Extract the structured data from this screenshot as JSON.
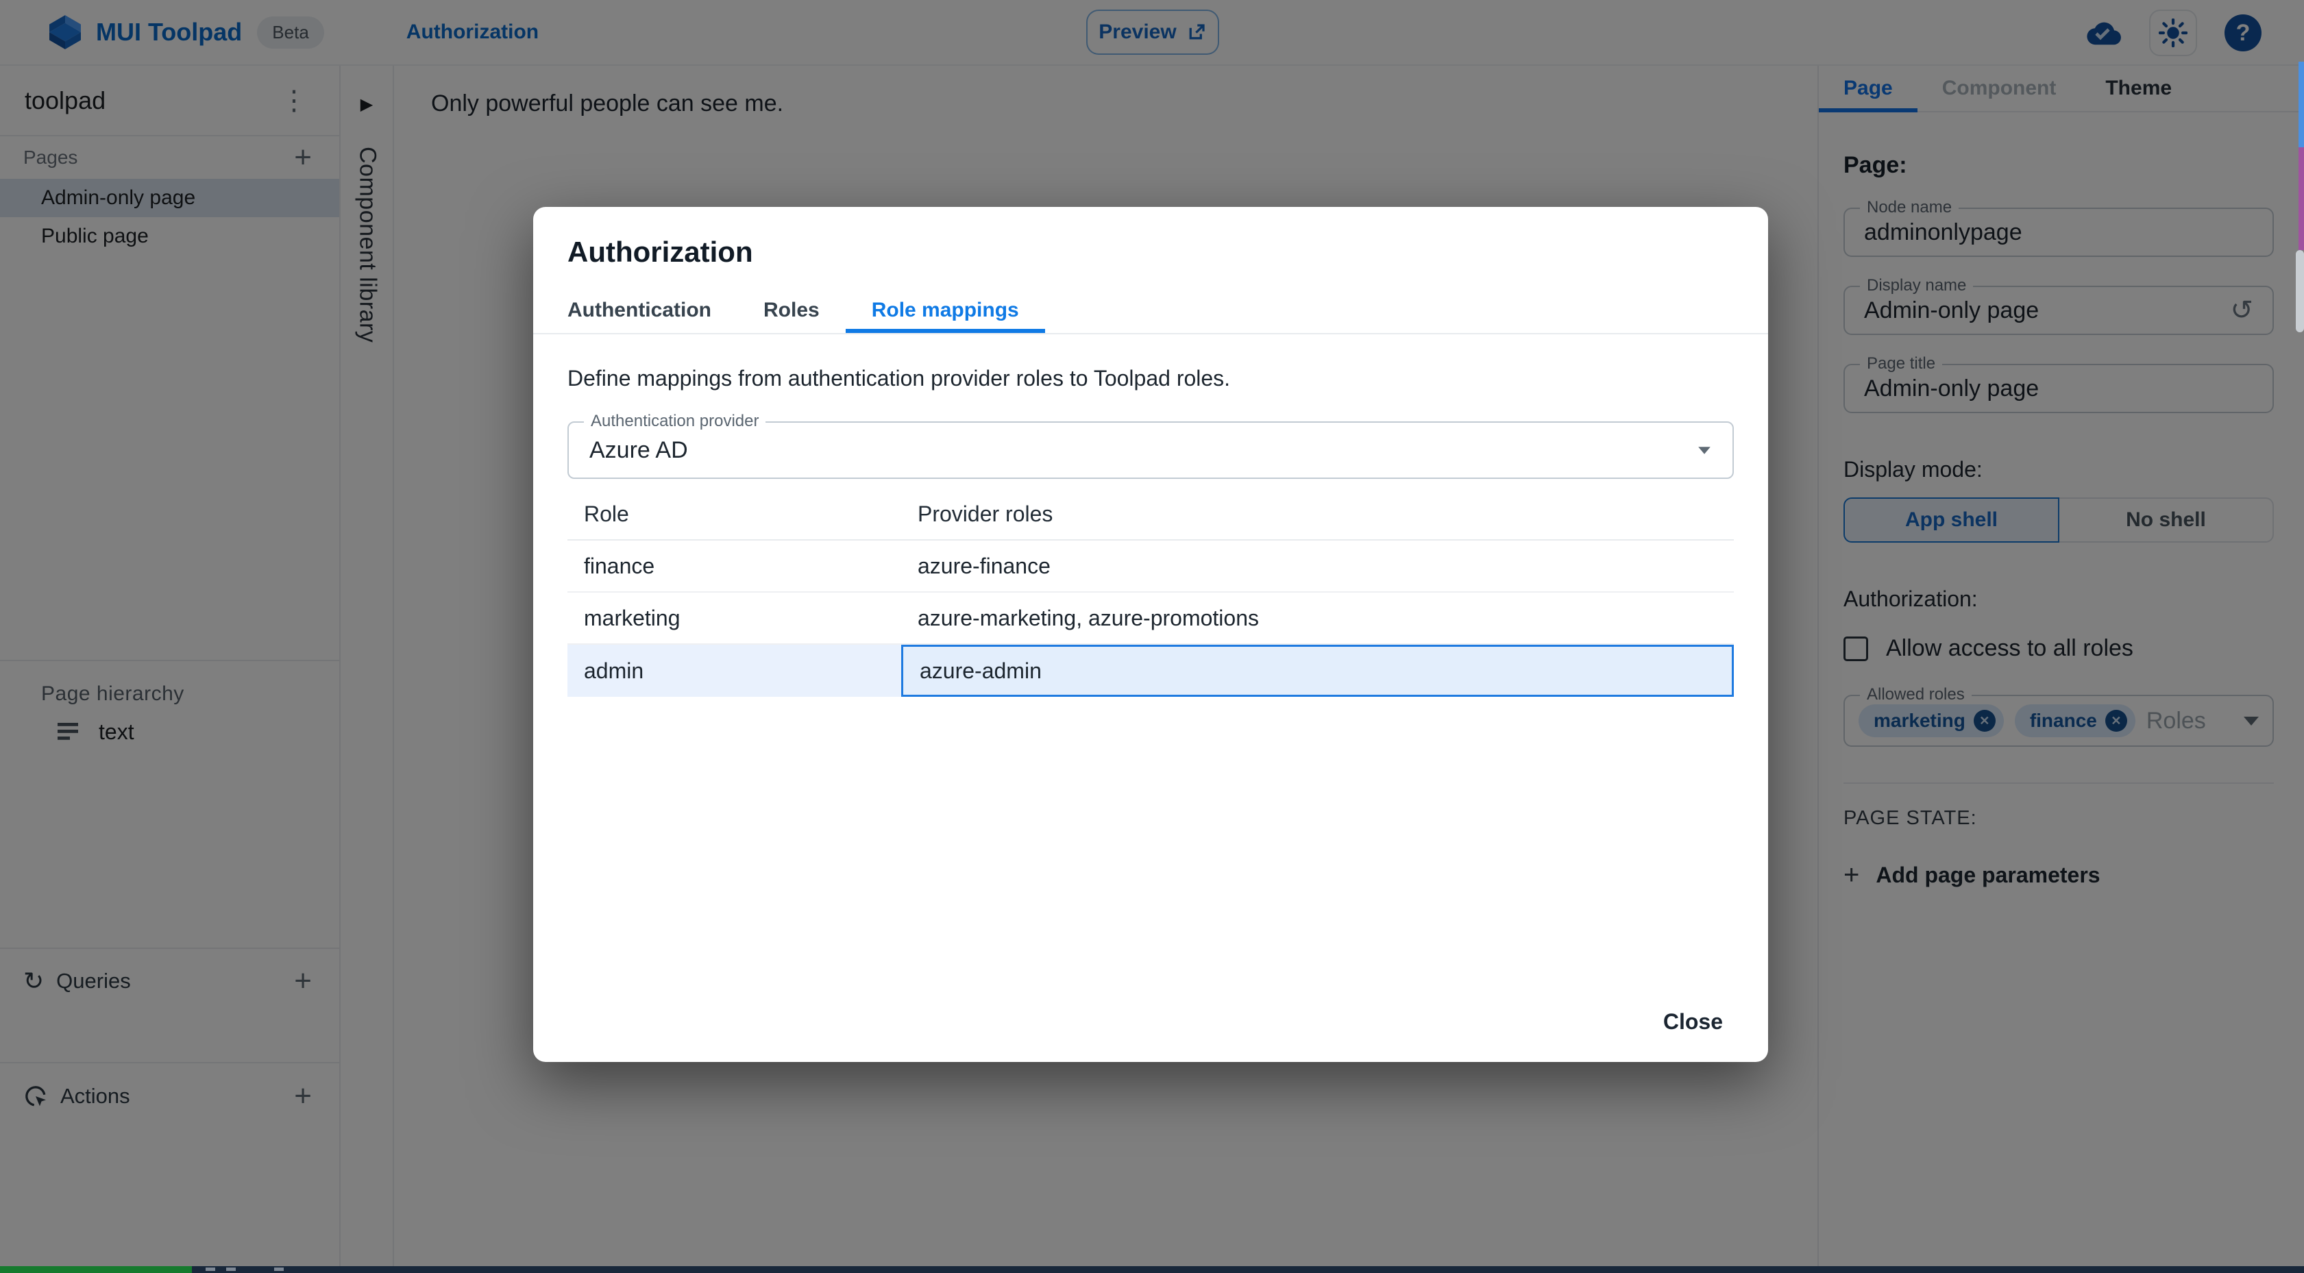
{
  "header": {
    "app_title": "MUI Toolpad",
    "beta_badge": "Beta",
    "breadcrumb": "Authorization",
    "preview_button": "Preview"
  },
  "explorer": {
    "app_name": "toolpad",
    "pages_header": "Pages",
    "pages": [
      {
        "label": "Admin-only page",
        "selected": true
      },
      {
        "label": "Public page",
        "selected": false
      }
    ],
    "hierarchy_header": "Page hierarchy",
    "hierarchy_items": [
      {
        "label": "text"
      }
    ],
    "queries_header": "Queries",
    "actions_header": "Actions"
  },
  "component_library": {
    "label": "Component library"
  },
  "canvas": {
    "text": "Only powerful people can see me."
  },
  "dialog": {
    "title": "Authorization",
    "tabs": [
      {
        "label": "Authentication",
        "active": false
      },
      {
        "label": "Roles",
        "active": false
      },
      {
        "label": "Role mappings",
        "active": true
      }
    ],
    "description": "Define mappings from authentication provider roles to Toolpad roles.",
    "provider_select": {
      "label": "Authentication provider",
      "value": "Azure AD"
    },
    "table": {
      "columns": [
        "Role",
        "Provider roles"
      ],
      "rows": [
        {
          "role": "finance",
          "provider_roles": "azure-finance",
          "highlighted": false
        },
        {
          "role": "marketing",
          "provider_roles": "azure-marketing, azure-promotions",
          "highlighted": false
        },
        {
          "role": "admin",
          "provider_roles": "azure-admin",
          "highlighted": true
        }
      ]
    },
    "close_button": "Close"
  },
  "inspector": {
    "tabs": [
      {
        "label": "Page",
        "active": true
      },
      {
        "label": "Component",
        "disabled": true
      },
      {
        "label": "Theme",
        "active": false
      }
    ],
    "section_title": "Page:",
    "fields": [
      {
        "label": "Node name",
        "value": "adminonlypage"
      },
      {
        "label": "Display name",
        "value": "Admin-only page",
        "has_reset": true
      },
      {
        "label": "Page title",
        "value": "Admin-only page"
      }
    ],
    "display_mode": {
      "label": "Display mode:",
      "options": [
        {
          "label": "App shell",
          "selected": true
        },
        {
          "label": "No shell",
          "selected": false
        }
      ]
    },
    "authorization": {
      "label": "Authorization:",
      "checkbox_label": "Allow access to all roles",
      "checked": false,
      "allowed_roles": {
        "label": "Allowed roles",
        "chips": [
          "marketing",
          "finance"
        ],
        "placeholder": "Roles"
      }
    },
    "page_state": {
      "label": "PAGE STATE:",
      "add_button": "Add page parameters"
    }
  },
  "icons": {
    "kebab": "⋮",
    "plus": "+",
    "collapse_arrow": "▶",
    "queries": "↻",
    "reset": "↺",
    "help": "?",
    "chip_delete": "✕"
  },
  "colors": {
    "accent_blue": "#1273e6",
    "brand_blue": "#0b6bcb",
    "selected_row": "#e9f1fd",
    "cell_focus_border": "#1e7ae0",
    "backdrop": "rgba(0,0,0,0.5)",
    "taskbar": "#18273a",
    "taskbar_green": "#157a2e"
  }
}
